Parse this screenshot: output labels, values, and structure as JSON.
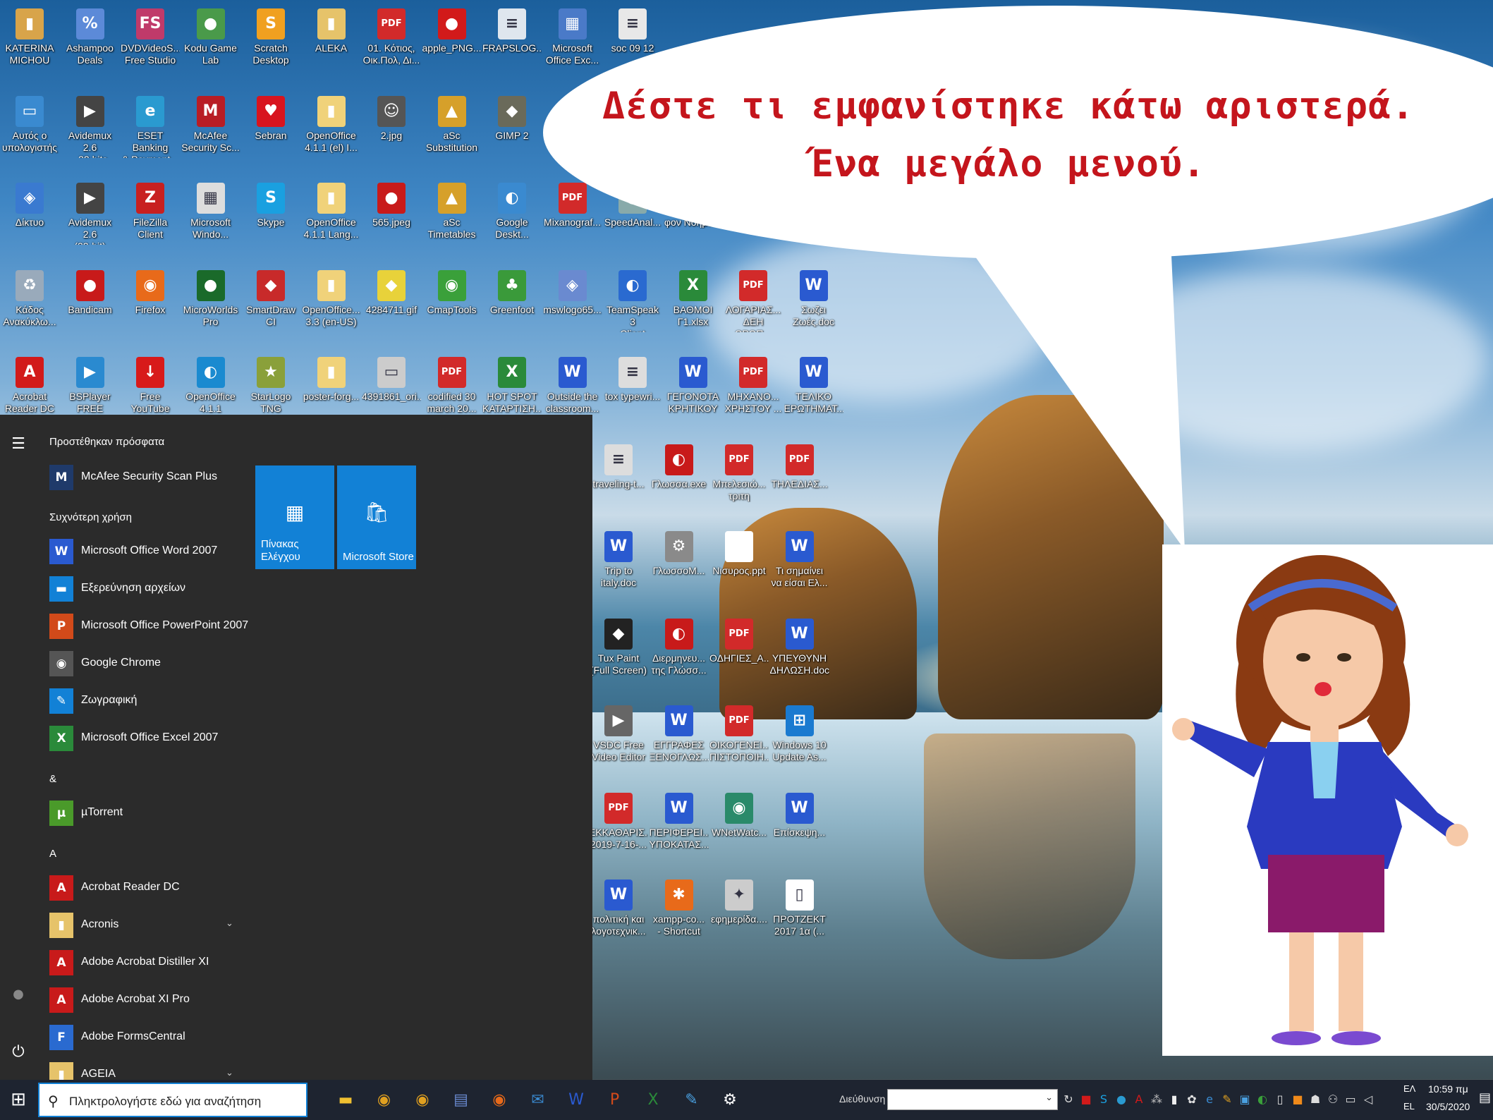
{
  "speech": {
    "line1": "Δέστε τι εμφανίστηκε κάτω αριστερά.",
    "line2": "Ένα μεγάλο μενού."
  },
  "desktop_icons": [
    {
      "label": "KATERINA\nMICHOU",
      "icon": "user-folder-icon",
      "color": "#d8a44a",
      "glyph": "▮"
    },
    {
      "label": "Ashampoo\nDeals",
      "icon": "ashampoo-icon",
      "color": "#5c8ad8",
      "glyph": "%"
    },
    {
      "label": "DVDVideoS...\nFree Studio",
      "icon": "dvdvideosoft-icon",
      "color": "#c03a6a",
      "glyph": "FS"
    },
    {
      "label": "Kodu Game\nLab",
      "icon": "kodu-icon",
      "color": "#4a9a4a",
      "glyph": "●"
    },
    {
      "label": "Scratch\nDesktop",
      "icon": "scratch-icon",
      "color": "#f0a020",
      "glyph": "S"
    },
    {
      "label": "ALEKA",
      "icon": "folder-icon",
      "color": "#e6c36a",
      "glyph": "▮"
    },
    {
      "label": "01. Κότιος,\nΟικ.Πολ, Δι...",
      "icon": "pdf-icon",
      "color": "#d22a2a",
      "glyph": "PDF"
    },
    {
      "label": "apple_PNG...",
      "icon": "apple-image-icon",
      "color": "#d21a1a",
      "glyph": "●"
    },
    {
      "label": "FRAPSLOG...",
      "icon": "text-file-icon",
      "color": "#dfe6ee",
      "glyph": "≡"
    },
    {
      "label": "Microsoft\nOffice Exc...",
      "icon": "excel-shortcut-icon",
      "color": "#4a7ac8",
      "glyph": "▦"
    },
    {
      "label": "soc 09 12",
      "icon": "document-icon",
      "color": "#e8e8e8",
      "glyph": "≡"
    },
    {
      "label": "Αυτός ο\nυπολογιστής",
      "icon": "this-pc-icon",
      "color": "#3a8ad0",
      "glyph": "▭"
    },
    {
      "label": "Avidemux 2.6\n- 32 bits (32...",
      "icon": "avidemux-icon",
      "color": "#444",
      "glyph": "▶"
    },
    {
      "label": "ESET Banking\n& Payment...",
      "icon": "eset-icon",
      "color": "#2a9ad0",
      "glyph": "e"
    },
    {
      "label": "McAfee\nSecurity Sc...",
      "icon": "mcafee-icon",
      "color": "#b81d25",
      "glyph": "M"
    },
    {
      "label": "Sebran",
      "icon": "heart-icon",
      "color": "#d8141e",
      "glyph": "♥"
    },
    {
      "label": "OpenOffice\n4.1.1 (el) I...",
      "icon": "folder-icon",
      "color": "#f0d27a",
      "glyph": "▮"
    },
    {
      "label": "2.jpg",
      "icon": "photo-icon",
      "color": "#555",
      "glyph": "☺"
    },
    {
      "label": "aSc\nSubstitution",
      "icon": "asc-icon",
      "color": "#d6a02a",
      "glyph": "▲"
    },
    {
      "label": "GIMP 2",
      "icon": "gimp-icon",
      "color": "#6a6a5a",
      "glyph": "◆"
    },
    {
      "label": "Δίκτυο",
      "icon": "network-icon",
      "color": "#3a7ad0",
      "glyph": "◈"
    },
    {
      "label": "Avidemux 2.6\n(32-bit)",
      "icon": "avidemux-icon",
      "color": "#444",
      "glyph": "▶"
    },
    {
      "label": "FileZilla\nClient",
      "icon": "filezilla-icon",
      "color": "#c82020",
      "glyph": "Z"
    },
    {
      "label": "Microsoft\nWindo...",
      "icon": "windows-shortcut-icon",
      "color": "#ddd",
      "glyph": "▦"
    },
    {
      "label": "Skype",
      "icon": "skype-icon",
      "color": "#1aa0e0",
      "glyph": "S"
    },
    {
      "label": "OpenOffice\n4.1.1 Lang...",
      "icon": "folder-icon",
      "color": "#f0d27a",
      "glyph": "▮"
    },
    {
      "label": "565.jpeg",
      "icon": "photo-icon",
      "color": "#c81a1a",
      "glyph": "●"
    },
    {
      "label": "aSc\nTimetables",
      "icon": "asc-icon",
      "color": "#d6a02a",
      "glyph": "▲"
    },
    {
      "label": "Google\nDeskt...",
      "icon": "google-desktop-icon",
      "color": "#3a8ad0",
      "glyph": "◐"
    },
    {
      "label": "Mixanograf...",
      "icon": "pdf-icon",
      "color": "#d22a2a",
      "glyph": "PDF"
    },
    {
      "label": "SpeedAnal...",
      "icon": "app-icon",
      "color": "#8aa",
      "glyph": "◉"
    },
    {
      "label": "φον Νόημα...",
      "icon": "document-icon",
      "color": "#ddd",
      "glyph": "≡"
    },
    {
      "label": "Κάδος\nΑνακύκλω...",
      "icon": "recycle-bin-icon",
      "color": "#9ab",
      "glyph": "♻"
    },
    {
      "label": "Bandicam",
      "icon": "bandicam-icon",
      "color": "#c81a1a",
      "glyph": "●"
    },
    {
      "label": "Firefox",
      "icon": "firefox-icon",
      "color": "#e86a1a",
      "glyph": "◉"
    },
    {
      "label": "MicroWorlds\nPro",
      "icon": "microworlds-icon",
      "color": "#1a6a2a",
      "glyph": "●"
    },
    {
      "label": "SmartDraw CI",
      "icon": "smartdraw-icon",
      "color": "#c82a2a",
      "glyph": "◆"
    },
    {
      "label": "OpenOffice...\n3.3 (en-US) ...",
      "icon": "folder-icon",
      "color": "#f0d27a",
      "glyph": "▮"
    },
    {
      "label": "4284711.gif",
      "icon": "image-icon",
      "color": "#e8d23a",
      "glyph": "◆"
    },
    {
      "label": "CmapTools",
      "icon": "cmaptools-icon",
      "color": "#3aa03a",
      "glyph": "◉"
    },
    {
      "label": "Greenfoot",
      "icon": "greenfoot-icon",
      "color": "#3a9a3a",
      "glyph": "♣"
    },
    {
      "label": "mswlogo65...",
      "icon": "setup-icon",
      "color": "#6a8ad0",
      "glyph": "◈"
    },
    {
      "label": "TeamSpeak 3\nClient",
      "icon": "teamspeak-icon",
      "color": "#2a6ad0",
      "glyph": "◐"
    },
    {
      "label": "ΒΑΘΜΟΙ\nΓ1.xlsx",
      "icon": "excel-file-icon",
      "color": "#2a8a3a",
      "glyph": "X"
    },
    {
      "label": "ΛΟΓΑΡΙΑΣ...\nΔΕΗ ΩΡΩΠ...",
      "icon": "pdf-icon",
      "color": "#d22a2a",
      "glyph": "PDF"
    },
    {
      "label": "Σωζει\nΖωές.doc",
      "icon": "word-file-icon",
      "color": "#2a5ad0",
      "glyph": "W"
    },
    {
      "label": "Acrobat\nReader DC",
      "icon": "acrobat-icon",
      "color": "#d21a1a",
      "glyph": "A"
    },
    {
      "label": "BSPlayer\nFREE",
      "icon": "bsplayer-icon",
      "color": "#2a8ad0",
      "glyph": "▶"
    },
    {
      "label": "Free YouTube\nDownload",
      "icon": "youtube-download-icon",
      "color": "#d81a1a",
      "glyph": "↓"
    },
    {
      "label": "OpenOffice\n4.1.1",
      "icon": "openoffice-icon",
      "color": "#1a8ad0",
      "glyph": "◐"
    },
    {
      "label": "StarLogo\nTNG",
      "icon": "starlogo-icon",
      "color": "#8aa03a",
      "glyph": "★"
    },
    {
      "label": "poster-forg...",
      "icon": "folder-icon",
      "color": "#f0d27a",
      "glyph": "▮"
    },
    {
      "label": "4391861_ori...",
      "icon": "image-icon",
      "color": "#ccc",
      "glyph": "▭"
    },
    {
      "label": "codified 30\nmarch 20...",
      "icon": "pdf-icon",
      "color": "#d22a2a",
      "glyph": "PDF"
    },
    {
      "label": "HOT SPOT\nΚΑΤΑΡΤΙΣΗ...",
      "icon": "excel-file-icon",
      "color": "#2a8a3a",
      "glyph": "X"
    },
    {
      "label": "Outside the\nclassroom...",
      "icon": "word-file-icon",
      "color": "#2a5ad0",
      "glyph": "W"
    },
    {
      "label": "tox typewri...",
      "icon": "text-file-icon",
      "color": "#ddd",
      "glyph": "≡"
    },
    {
      "label": "ΓΕΓΟΝΟΤΑ\nΚΡΗΤΙΚΟΥ ...",
      "icon": "word-file-icon",
      "color": "#2a5ad0",
      "glyph": "W"
    },
    {
      "label": "ΜΗΧΑΝΟ...\nΧΡΗΣΤΟΥ ...",
      "icon": "pdf-icon",
      "color": "#d22a2a",
      "glyph": "PDF"
    },
    {
      "label": "ΤΕΛΙΚΟ\nΕΡΩΤΗΜΑΤ...",
      "icon": "word-file-icon",
      "color": "#2a5ad0",
      "glyph": "W"
    },
    {
      "label": "traveling-t...",
      "icon": "text-file-icon",
      "color": "#ddd",
      "glyph": "≡"
    },
    {
      "label": "Γλωσσα.exe",
      "icon": "glossa-icon",
      "color": "#c81a1a",
      "glyph": "◐"
    },
    {
      "label": "Μπελεσιώ...\nτριτη",
      "icon": "pdf-icon",
      "color": "#d22a2a",
      "glyph": "PDF"
    },
    {
      "label": "ΤΗΛΕΔΙΑΣ...",
      "icon": "pdf-icon",
      "color": "#d22a2a",
      "glyph": "PDF"
    },
    {
      "label": "Trip to\nitaly.doc",
      "icon": "word-file-icon",
      "color": "#2a5ad0",
      "glyph": "W"
    },
    {
      "label": "ΓλωσσοΜ...",
      "icon": "settings-app-icon",
      "color": "#8a8a8a",
      "glyph": "⚙"
    },
    {
      "label": "Νισυρος.ppt",
      "icon": "blank-file-icon",
      "color": "#fff",
      "glyph": ""
    },
    {
      "label": "Τι σημαίνει\nνα είσαι Ελ...",
      "icon": "word-file-icon",
      "color": "#2a5ad0",
      "glyph": "W"
    },
    {
      "label": "Tux Paint\n(Full Screen)",
      "icon": "tuxpaint-icon",
      "color": "#222",
      "glyph": "◆"
    },
    {
      "label": "Διερμηνευ...\nτης Γλώσσ...",
      "icon": "glossa-icon",
      "color": "#c81a1a",
      "glyph": "◐"
    },
    {
      "label": "ΟΔΗΓΙΕΣ_Α...",
      "icon": "pdf-icon",
      "color": "#d22a2a",
      "glyph": "PDF"
    },
    {
      "label": "ΥΠΕΥΘΥΝΗ\nΔΗΛΩΣΗ.doc",
      "icon": "word-file-icon",
      "color": "#2a5ad0",
      "glyph": "W"
    },
    {
      "label": "VSDC Free\nVideo Editor",
      "icon": "vsdc-icon",
      "color": "#666",
      "glyph": "▶"
    },
    {
      "label": "ΕΓΓΡΑΦΕΣ\nΞΕΝΟΓΛΩΣ...",
      "icon": "word-file-icon",
      "color": "#2a5ad0",
      "glyph": "W"
    },
    {
      "label": "ΟΙΚΟΓΕΝΕΙ...\nΠΙΣΤΟΠΟΙΗ...",
      "icon": "pdf-icon",
      "color": "#d22a2a",
      "glyph": "PDF"
    },
    {
      "label": "Windows 10\nUpdate As...",
      "icon": "windows-update-icon",
      "color": "#1a7ad0",
      "glyph": "⊞"
    },
    {
      "label": "ΕΚΚΑΘΑΡΙΣ...\n2019-7-16-...",
      "icon": "pdf-icon",
      "color": "#d22a2a",
      "glyph": "PDF"
    },
    {
      "label": "ΠΕΡΙΦΕΡΕΙ...\nΥΠΟΚΑΤΑΣ...",
      "icon": "word-file-icon",
      "color": "#2a5ad0",
      "glyph": "W"
    },
    {
      "label": "WNetWatc...",
      "icon": "wnetwatcher-icon",
      "color": "#2a8a6a",
      "glyph": "◉"
    },
    {
      "label": "Επίσκεψη...",
      "icon": "word-file-icon",
      "color": "#2a5ad0",
      "glyph": "W"
    },
    {
      "label": "πολιτική και\nλογοτεχνικ...",
      "icon": "word-file-icon",
      "color": "#2a5ad0",
      "glyph": "W"
    },
    {
      "label": "xampp-co...\n- Shortcut",
      "icon": "xampp-icon",
      "color": "#e86a1a",
      "glyph": "✱"
    },
    {
      "label": "εφημερίδα....",
      "icon": "image-icon",
      "color": "#ccc",
      "glyph": "✦"
    },
    {
      "label": "ΠΡΟΤΖΕΚΤ\n2017 1α (...",
      "icon": "blank-file-icon",
      "color": "#fff",
      "glyph": "▯"
    }
  ],
  "start_menu": {
    "recently_added_header": "Προστέθηκαν πρόσφατα",
    "recent": [
      {
        "name": "McAfee Security Scan Plus",
        "icon": "mcafee-icon",
        "color": "#1f3a6a",
        "glyph": "M"
      }
    ],
    "most_used_header": "Συχνότερη χρήση",
    "most_used": [
      {
        "name": "Microsoft Office Word 2007",
        "icon": "word-icon",
        "color": "#2a5ad0",
        "glyph": "W"
      },
      {
        "name": "Εξερεύνηση αρχείων",
        "icon": "file-explorer-icon",
        "color": "#1281d6",
        "glyph": "▬"
      },
      {
        "name": "Microsoft Office PowerPoint 2007",
        "icon": "powerpoint-icon",
        "color": "#d24a1a",
        "glyph": "P"
      },
      {
        "name": "Google Chrome",
        "icon": "chrome-icon",
        "color": "#555",
        "glyph": "◉"
      },
      {
        "name": "Ζωγραφική",
        "icon": "paint-icon",
        "color": "#1281d6",
        "glyph": "✎"
      },
      {
        "name": "Microsoft Office Excel 2007",
        "icon": "excel-icon",
        "color": "#2a8a3a",
        "glyph": "X"
      }
    ],
    "amp_header": "&",
    "amp_apps": [
      {
        "name": "µTorrent",
        "icon": "utorrent-icon",
        "color": "#4a9a2a",
        "glyph": "µ"
      }
    ],
    "a_header": "A",
    "a_apps": [
      {
        "name": "Acrobat Reader DC",
        "icon": "acrobat-icon",
        "color": "#c81a1a",
        "glyph": "A",
        "expandable": false
      },
      {
        "name": "Acronis",
        "icon": "folder-icon",
        "color": "#e6c36a",
        "glyph": "▮",
        "expandable": true
      },
      {
        "name": "Adobe Acrobat Distiller XI",
        "icon": "distiller-icon",
        "color": "#c81a1a",
        "glyph": "A",
        "expandable": false
      },
      {
        "name": "Adobe Acrobat XI Pro",
        "icon": "acrobat-icon",
        "color": "#c81a1a",
        "glyph": "A",
        "expandable": false
      },
      {
        "name": "Adobe FormsCentral",
        "icon": "formscentral-icon",
        "color": "#2a6ad0",
        "glyph": "F",
        "expandable": false
      },
      {
        "name": "AGEIA",
        "icon": "folder-icon",
        "color": "#e6c36a",
        "glyph": "▮",
        "expandable": true
      }
    ],
    "tiles": [
      {
        "name": "Πίνακας\nΕλέγχου",
        "icon": "control-panel-icon",
        "glyph": "▦"
      },
      {
        "name": "Microsoft Store",
        "icon": "store-icon",
        "glyph": "🛍"
      }
    ],
    "chevron": "⌄",
    "hamburger_glyph": "☰",
    "user_glyph": "●",
    "power_glyph": "⏻"
  },
  "taskbar": {
    "start_glyph": "⊞",
    "search_placeholder": "Πληκτρολογήστε εδώ για αναζήτηση",
    "search_glyph": "⚲",
    "pinned": [
      {
        "icon": "file-explorer-icon",
        "glyph": "▬",
        "color": "#f0c030"
      },
      {
        "icon": "chrome-icon",
        "glyph": "◉",
        "color": "#e0a020"
      },
      {
        "icon": "chrome-icon",
        "glyph": "◉",
        "color": "#e0a020"
      },
      {
        "icon": "installer-icon",
        "glyph": "▤",
        "color": "#6a8ad0"
      },
      {
        "icon": "firefox-icon",
        "glyph": "◉",
        "color": "#e86a1a"
      },
      {
        "icon": "mail-icon",
        "glyph": "✉",
        "color": "#3a8ad0"
      },
      {
        "icon": "word-icon",
        "glyph": "W",
        "color": "#2a5ad0"
      },
      {
        "icon": "powerpoint-icon",
        "glyph": "P",
        "color": "#d24a1a"
      },
      {
        "icon": "excel-icon",
        "glyph": "X",
        "color": "#2a8a3a"
      },
      {
        "icon": "paint-icon",
        "glyph": "✎",
        "color": "#4aa0e0"
      },
      {
        "icon": "settings-icon",
        "glyph": "⚙",
        "color": "#ffffff"
      }
    ],
    "address_label": "Διεύθυνση",
    "address_value": "",
    "tray_icons": [
      {
        "icon": "refresh-icon",
        "glyph": "↻",
        "color": "#ddd"
      },
      {
        "icon": "mcafee-tray-icon",
        "glyph": "■",
        "color": "#d21a1a"
      },
      {
        "icon": "skype-tray-icon",
        "glyph": "S",
        "color": "#1aa0e0"
      },
      {
        "icon": "eset-tray-icon",
        "glyph": "●",
        "color": "#2a9ad0"
      },
      {
        "icon": "acrobat-tray-icon",
        "glyph": "A",
        "color": "#d21a1a"
      },
      {
        "icon": "network-tray-icon",
        "glyph": "⁂",
        "color": "#c0c0c0"
      },
      {
        "icon": "microphone-icon",
        "glyph": "▮",
        "color": "#eee"
      },
      {
        "icon": "cmap-tray-icon",
        "glyph": "✿",
        "color": "#e0e0e0"
      },
      {
        "icon": "edge-tray-icon",
        "glyph": "e",
        "color": "#3a8ad0"
      },
      {
        "icon": "paint-tray-icon",
        "glyph": "✎",
        "color": "#e0a020"
      },
      {
        "icon": "chat-tray-icon",
        "glyph": "▣",
        "color": "#4aa0e0"
      },
      {
        "icon": "google-tray-icon",
        "glyph": "◐",
        "color": "#3aa03a"
      },
      {
        "icon": "file-tray-icon",
        "glyph": "▯",
        "color": "#ddd"
      },
      {
        "icon": "orange-tray-icon",
        "glyph": "■",
        "color": "#f08a1a"
      },
      {
        "icon": "sync-tray-icon",
        "glyph": "☗",
        "color": "#ddd"
      },
      {
        "icon": "people-tray-icon",
        "glyph": "⚇",
        "color": "#ddd"
      },
      {
        "icon": "display-tray-icon",
        "glyph": "▭",
        "color": "#ddd"
      },
      {
        "icon": "volume-icon",
        "glyph": "◁",
        "color": "#ddd"
      }
    ],
    "lang_top": "ΕΛ",
    "lang_bottom": "EL",
    "time": "10:59 πμ",
    "date": "30/5/2020",
    "notification_glyph": "▤"
  }
}
